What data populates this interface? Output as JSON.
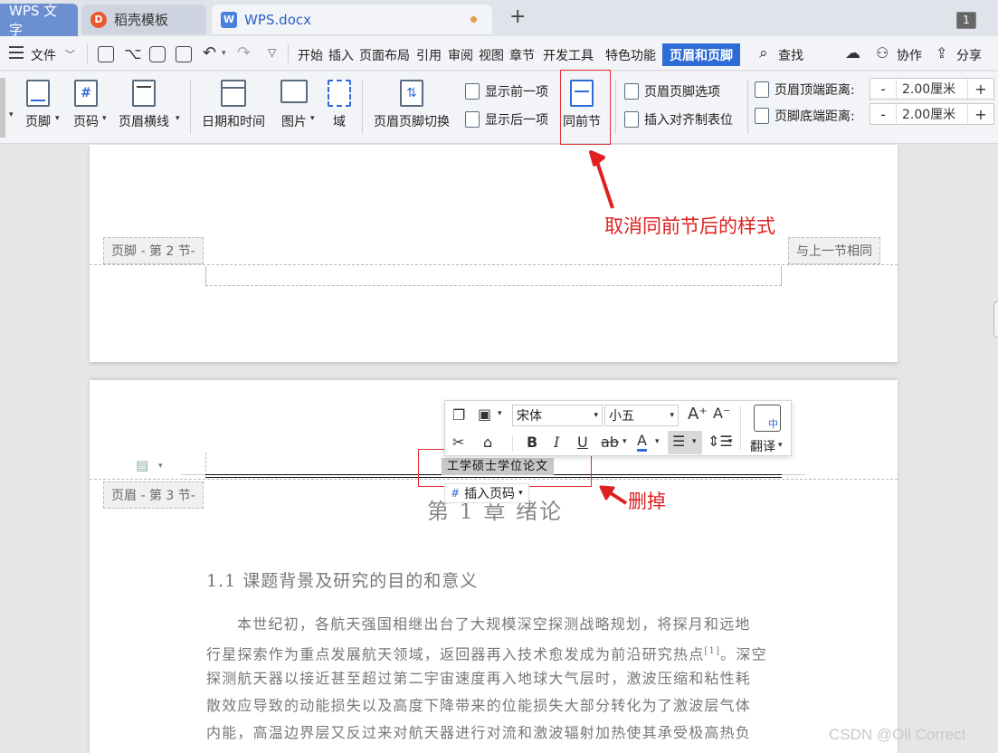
{
  "tabs": {
    "wps": "WPS 文字",
    "docer": "稻壳模板",
    "doc": "WPS.docx",
    "new": "+",
    "counter": "1"
  },
  "menu": {
    "file": "文件",
    "items": [
      "开始",
      "插入",
      "页面布局",
      "引用",
      "审阅",
      "视图",
      "章节",
      "开发工具",
      "特色功能"
    ],
    "active": "页眉和页脚",
    "search": "查找",
    "collab": "协作",
    "share": "分享"
  },
  "ribbon": {
    "footer": "页脚",
    "page_num": "页码",
    "header_line": "页眉横线",
    "datetime": "日期和时间",
    "picture": "图片",
    "field": "域",
    "switch": "页眉页脚切换",
    "show_prev": "显示前一项",
    "show_next": "显示后一项",
    "same_prev": "同前节",
    "options": "页眉页脚选项",
    "insert_tab": "插入对齐制表位",
    "top_dist_label": "页眉顶端距离:",
    "top_dist_value": "2.00厘米",
    "bottom_dist_label": "页脚底端距离:",
    "bottom_dist_value": "2.00厘米",
    "minus": "-",
    "plus": "+"
  },
  "annotations": {
    "cancel_same": "取消同前节后的样式",
    "delete": "删掉"
  },
  "document": {
    "footer_tag": "页脚 - 第 2 节-",
    "same_as_prev": "与上一节相同",
    "header_tag": "页眉 - 第 3 节-",
    "header_text": "工学硕士学位论文",
    "insert_page_num": "插入页码",
    "chapter_title": "第 1 章  绪论",
    "section_title": "1.1  课题背景及研究的目的和意义",
    "para_lines": [
      "本世纪初，各航天强国相继出台了大规模深空探测战略规划，将探月和远地",
      "行星探索作为重点发展航天领域，返回器再入技术愈发成为前沿研究热点",
      "探测航天器以接近甚至超过第二宇宙速度再入地球大气层时，激波压缩和粘性耗",
      "散效应导致的动能损失以及高度下降带来的位能损失大部分转化为了激波层气体",
      "内能，高温边界层又反过来对航天器进行对流和激波辐射加热使其承受极高热负"
    ],
    "citation": "[1]",
    "line2_tail": "。深空"
  },
  "floatbar": {
    "font": "宋体",
    "size": "小五",
    "translate": "翻译"
  },
  "watermark": "CSDN @Oll Correct",
  "colors": {
    "accent": "#2f6bd6",
    "annotation": "#e02020"
  }
}
